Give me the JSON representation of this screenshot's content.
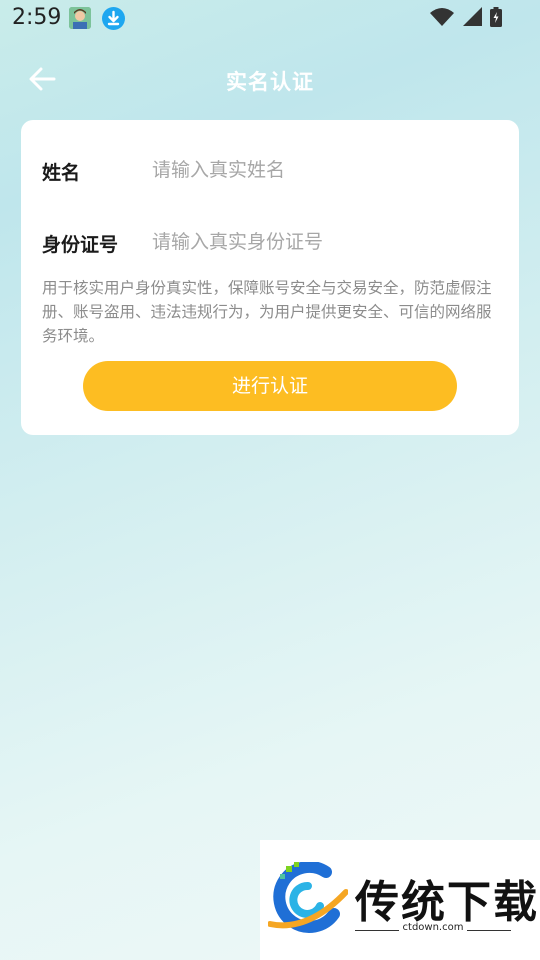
{
  "status_bar": {
    "time": "2:59"
  },
  "header": {
    "title": "实名认证"
  },
  "form": {
    "name_label": "姓名",
    "name_placeholder": "请输入真实姓名",
    "id_label": "身份证号",
    "id_placeholder": "请输入真实身份证号",
    "notice": "用于核实用户身份真实性，保障账号安全与交易安全，防范虚假注册、账号盗用、违法违规行为，为用户提供更安全、可信的网络服务环境。",
    "submit_label": "进行认证"
  },
  "watermark": {
    "text": "传统下载",
    "sub": "ctdown.com"
  },
  "colors": {
    "accent": "#fdbd22",
    "background_top": "#c9ecea",
    "card": "#ffffff"
  }
}
